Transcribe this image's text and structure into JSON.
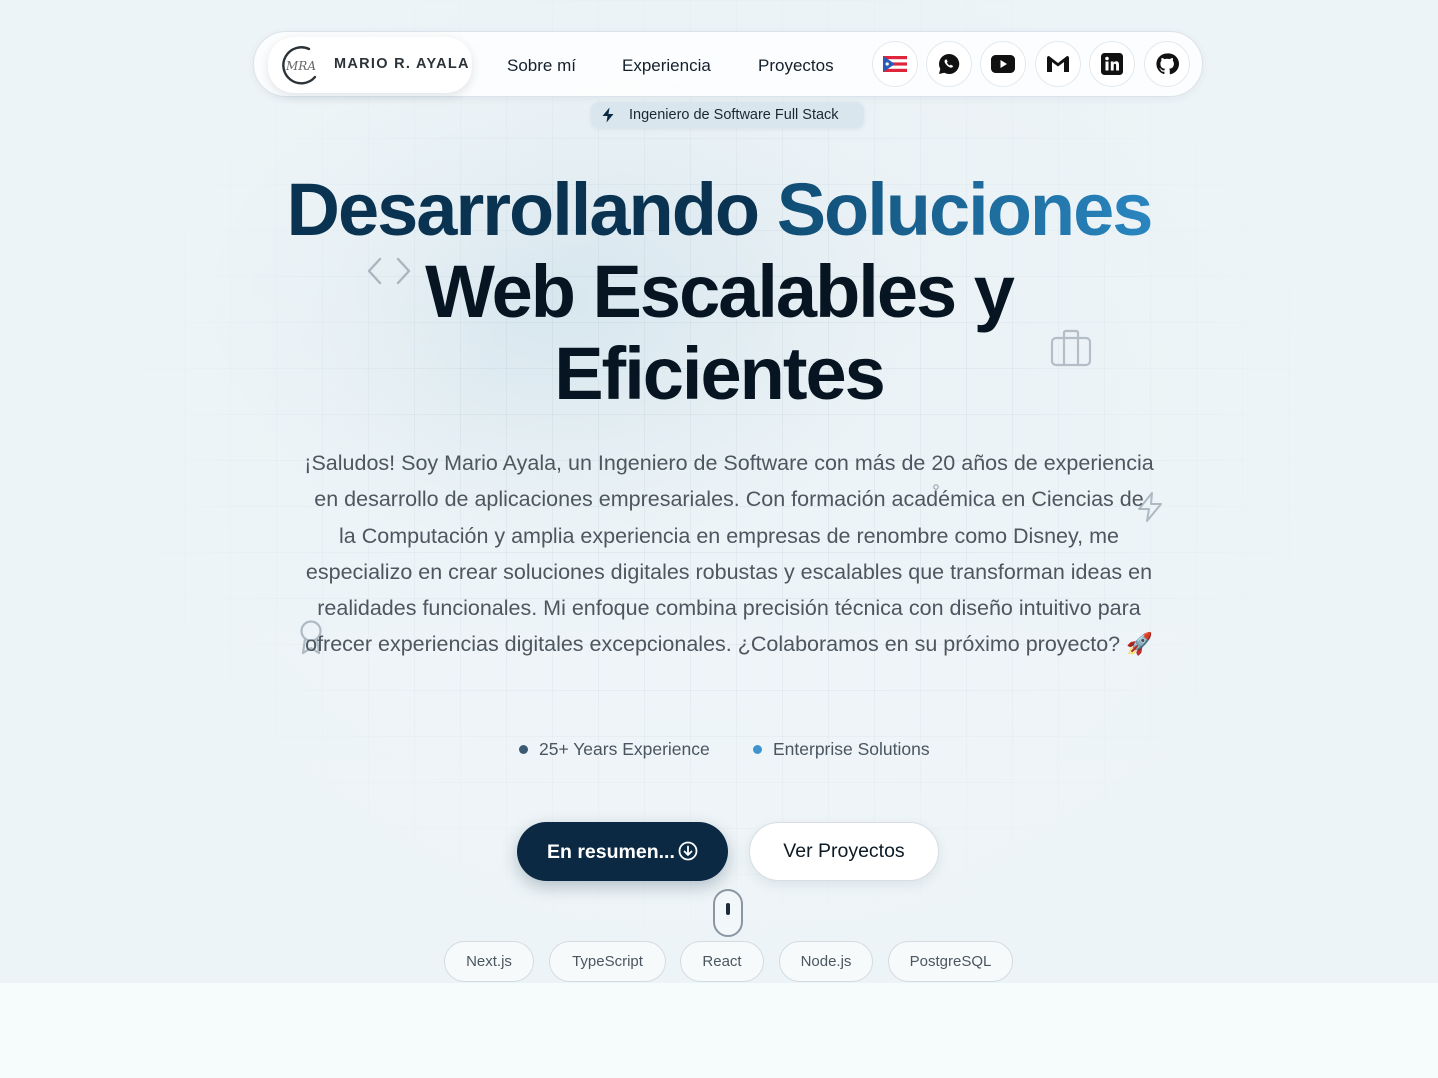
{
  "header": {
    "brand_name": "MARIO R. AYALA",
    "logo_alt": "MRA",
    "nav": [
      {
        "label": "Sobre mí"
      },
      {
        "label": "Experiencia"
      },
      {
        "label": "Proyectos"
      }
    ],
    "social_icons": [
      "puerto-rico-flag-icon",
      "whatsapp-icon",
      "youtube-icon",
      "gmail-icon",
      "linkedin-icon",
      "github-icon"
    ]
  },
  "hero": {
    "badge": "Ingeniero de Software Full Stack",
    "headline_part1": "Desarrollando",
    "headline_part2": "Soluciones",
    "headline_line2": "Web Escalables y",
    "headline_line3": "Eficientes",
    "intro": "¡Saludos! Soy Mario Ayala, un Ingeniero de Software con más de 20 años de experiencia en desarrollo de aplicaciones empresariales. Con formación académica en Ciencias de la Computación y amplia experiencia en empresas de renombre como Disney, me especializo en crear soluciones digitales robustas y escalables que transforman ideas en realidades funcionales. Mi enfoque combina precisión técnica con diseño intuitivo para ofrecer experiencias digitales excepcionales. ¿Colaboramos en su próximo proyecto? 🚀",
    "stats": [
      {
        "label": "25+ Years Experience",
        "color": "#3d5a73"
      },
      {
        "label": "Enterprise Solutions",
        "color": "#3d94cf"
      }
    ],
    "primary_button": "En resumen...",
    "secondary_button": "Ver Proyectos",
    "tech_tags": [
      "Next.js",
      "TypeScript",
      "React",
      "Node.js",
      "PostgreSQL"
    ]
  },
  "colors": {
    "primary": "#0b2942",
    "accent": "#2a86c0",
    "headline_dark": "#061521"
  }
}
